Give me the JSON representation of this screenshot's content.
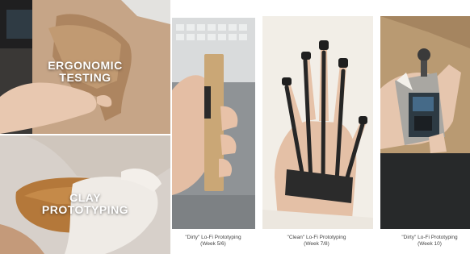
{
  "header": {
    "top_label": ""
  },
  "panels": {
    "ergonomic": {
      "line1": "ERGONOMIC",
      "line2": "TESTING"
    },
    "clay": {
      "line1": "CLAY",
      "line2": "PROTOTYPING"
    },
    "dirty_a": {
      "caption_line1": "\"Dirty\" Lo-Fi Prototyping",
      "caption_line2": "(Week 5/6)"
    },
    "clean": {
      "caption_line1": "\"Clean\" Lo-Fi Prototyping",
      "caption_line2": "(Week 7/8)"
    },
    "dirty_b": {
      "caption_line1": "\"Dirty\" Lo-Fi Prototyping",
      "caption_line2": "(Week 10)"
    }
  },
  "colors": {
    "cardboard": "#c4a07c",
    "clay": "#b07a3c",
    "skin": "#e3c3a8",
    "glove": "#f0ece6",
    "strap": "#2b2b2b",
    "wood": "#caa776"
  }
}
